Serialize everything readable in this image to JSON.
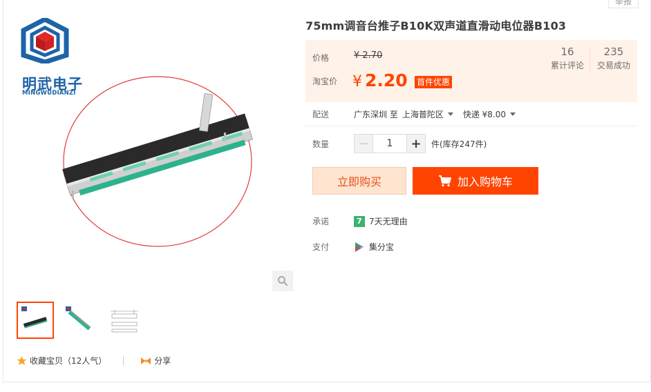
{
  "report": "举报",
  "product": {
    "title": "75mm调音台推子B10K双声道直滑动电位器B103"
  },
  "brand": {
    "name": "明武电子",
    "pinyin": "MINGWUDIANZI"
  },
  "price": {
    "label": "价格",
    "original": "¥ 2.70",
    "promo_label": "淘宝价",
    "currency": "¥",
    "promo": "2.20",
    "badge": "首件优惠"
  },
  "stats": {
    "reviews_count": "16",
    "reviews_label": "累计评论",
    "sold_count": "235",
    "sold_label": "交易成功"
  },
  "shipping": {
    "label": "配送",
    "from": "广东深圳 至",
    "to": "上海普陀区",
    "method": "快递 ¥8.00"
  },
  "quantity": {
    "label": "数量",
    "value": "1",
    "unit_stock": "件(库存247件)"
  },
  "buttons": {
    "buy_now": "立即购买",
    "add_cart": "加入购物车"
  },
  "promise": {
    "label": "承诺",
    "value": "7天无理由",
    "icon_char": "7"
  },
  "payment": {
    "label": "支付",
    "value": "集分宝"
  },
  "social": {
    "favorite": "收藏宝贝（12人气）",
    "share": "分享"
  },
  "colors": {
    "accent": "#ff4400",
    "brand_blue": "#1d63a8",
    "price_bg": "#fff2e8",
    "promise_green": "#3cb371"
  }
}
